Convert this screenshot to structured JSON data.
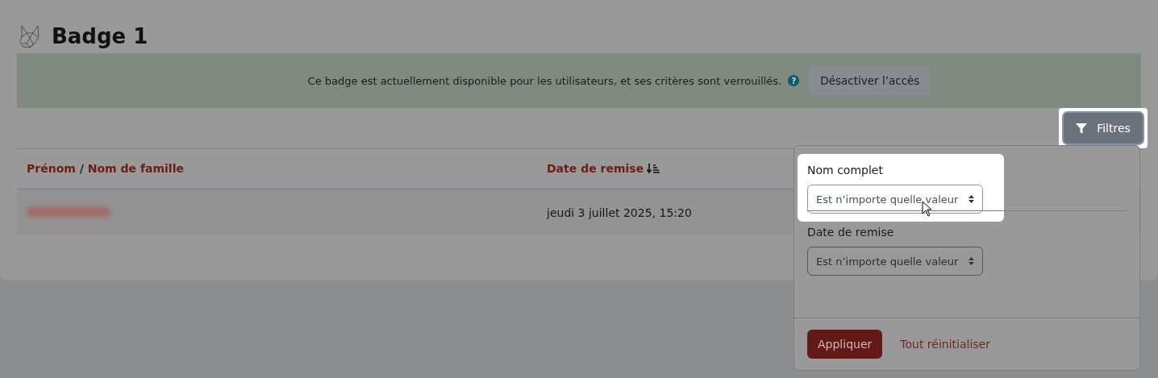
{
  "page": {
    "title": "Badge 1"
  },
  "alert": {
    "message": "Ce badge est actuellement disponible pour les utilisateurs, et ses critères sont verrouillés.",
    "help_icon": "?",
    "button": "Désactiver l’accès"
  },
  "filter_button": {
    "label": "Filtres",
    "highlighted": true
  },
  "table": {
    "columns": [
      {
        "kind": "name",
        "links": [
          "Prénom",
          "Nom de famille"
        ],
        "separator": "/"
      },
      {
        "kind": "date",
        "label": "Date de remise",
        "sorted": true
      }
    ],
    "rows": [
      {
        "date": "jeudi 3 juillet 2025, 15:20"
      }
    ]
  },
  "filters_panel": {
    "filters": [
      {
        "label": "Nom complet",
        "value": "Est n’importe quelle valeur",
        "highlighted": true
      },
      {
        "label": "Date de remise",
        "value": "Est n’importe quelle valeur",
        "highlighted": false
      }
    ],
    "apply": "Appliquer",
    "reset": "Tout réinitialiser"
  }
}
